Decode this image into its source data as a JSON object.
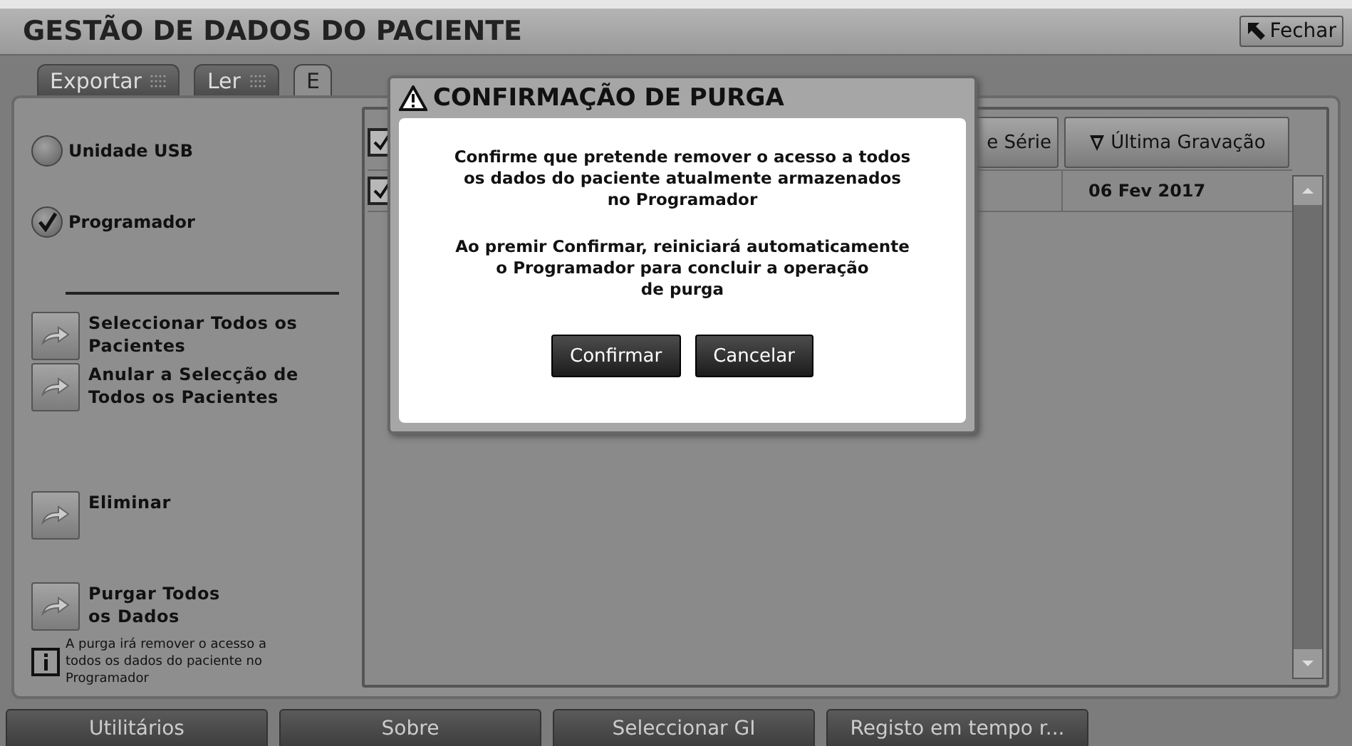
{
  "window": {
    "title": "GESTÃO DE DADOS DO PACIENTE",
    "close_button": "Fechar"
  },
  "tabs": [
    {
      "label": "Exportar",
      "selected": false
    },
    {
      "label": "Ler",
      "selected": false
    },
    {
      "label": "E",
      "selected": true
    }
  ],
  "sources": [
    {
      "label": "Unidade USB",
      "selected": false
    },
    {
      "label": "Programador",
      "selected": true
    }
  ],
  "actions": [
    {
      "label": "Seleccionar Todos os\nPacientes"
    },
    {
      "label": "Anular a Selecção de\nTodos os Pacientes"
    },
    {
      "label": "Eliminar"
    },
    {
      "label": "Purgar Todos\nos Dados"
    }
  ],
  "info_note": "A purga irá remover o acesso a\ntodos os dados do paciente no\nProgramador",
  "table": {
    "header_checked": true,
    "columns": [
      "e Série",
      "Última Gravação"
    ],
    "rows": [
      {
        "checked": true,
        "cells": [
          "",
          "06 Fev 2017"
        ]
      }
    ]
  },
  "dialog": {
    "title": "CONFIRMAÇÃO DE PURGA",
    "paragraphs": [
      "Confirme que pretende remover o acesso a todos\nos dados do paciente atualmente armazenados\nno Programador",
      "Ao premir Confirmar, reiniciará automaticamente\no Programador para concluir a operação\nde purga"
    ],
    "buttons": [
      "Confirmar",
      "Cancelar"
    ]
  },
  "bottom_nav": [
    "Utilitários",
    "Sobre",
    "Seleccionar GI",
    "Registo em tempo r..."
  ]
}
